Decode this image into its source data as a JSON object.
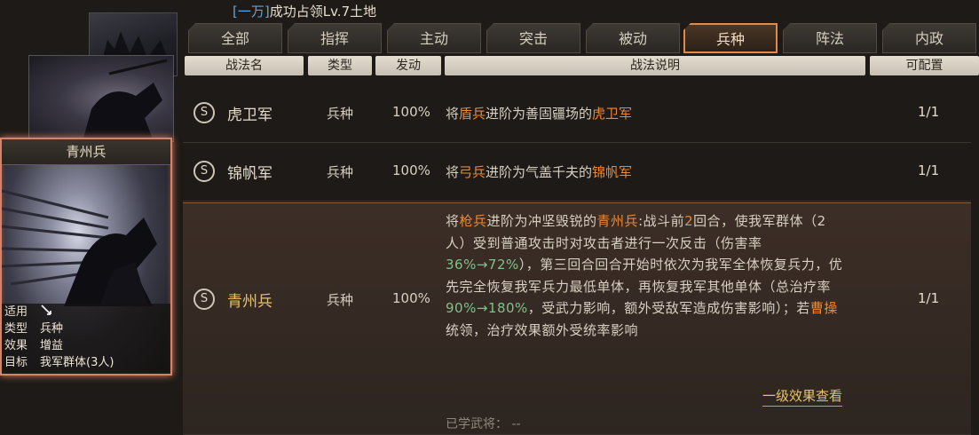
{
  "status": {
    "prefix": "[一万]",
    "text": "成功占领",
    "level": "Lv.7",
    "suffix": "土地"
  },
  "tabs": [
    {
      "label": "全部"
    },
    {
      "label": "指挥"
    },
    {
      "label": "主动"
    },
    {
      "label": "突击"
    },
    {
      "label": "被动"
    },
    {
      "label": "兵种",
      "active": true
    },
    {
      "label": "阵法"
    },
    {
      "label": "内政"
    }
  ],
  "headers": {
    "name": "战法名",
    "type": "类型",
    "rate": "发动",
    "desc": "战法说明",
    "config": "可配置"
  },
  "card": {
    "title": "青州兵",
    "rows": [
      {
        "key": "适用",
        "value": ""
      },
      {
        "key": "类型",
        "value": "兵种"
      },
      {
        "key": "效果",
        "value": "增益"
      },
      {
        "key": "目标",
        "value": "我军群体(3人)"
      }
    ]
  },
  "skills": [
    {
      "grade": "S",
      "name": "虎卫军",
      "type": "兵种",
      "rate": "100%",
      "desc": {
        "a": "将",
        "b": "盾兵",
        "c": "进阶为善固疆场的",
        "d": "虎卫军"
      },
      "config": "1/1"
    },
    {
      "grade": "S",
      "name": "锦帆军",
      "type": "兵种",
      "rate": "100%",
      "desc": {
        "a": "将",
        "b": "弓兵",
        "c": "进阶为气盖千夫的",
        "d": "锦帆军"
      },
      "config": "1/1"
    },
    {
      "grade": "S",
      "name": "青州兵",
      "type": "兵种",
      "rate": "100%",
      "desc": {
        "p1": "将",
        "p2": "枪兵",
        "p3": "进阶为冲坚毁锐的",
        "p4": "青州兵",
        "p5": ":战斗前",
        "p6": "2",
        "p7": "回合，使我军群体（2人）受到普通攻击时对攻击者进行一次反击（伤害率",
        "p8": "36%→72%",
        "p9": "），第三回合回合开始时依次为我军全体恢复兵力，优先完全恢复我军兵力最低单体，再恢复我军其他单体（总治疗率",
        "p10": "90%→180%",
        "p11": "，受武力影响，额外受敌军造成伤害影响）；若",
        "p12": "曹操",
        "p13": "统领，治疗效果额外受统率影响"
      },
      "config": "1/1",
      "more": "一级效果查看",
      "learned": "已学武将：  --"
    }
  ]
}
